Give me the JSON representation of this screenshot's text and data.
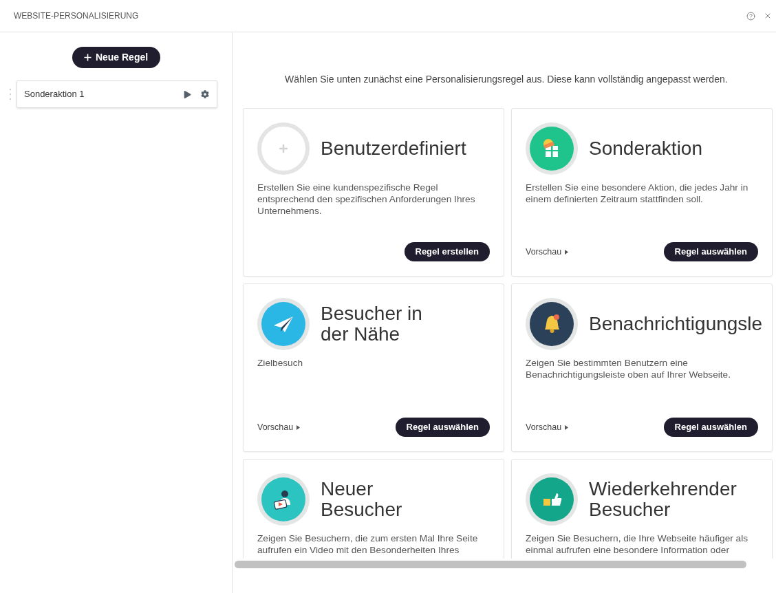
{
  "window": {
    "title": "WEBSITE-PERSONALISIERUNG"
  },
  "sidebar": {
    "new_rule_button": "Neue Regel",
    "rules": [
      {
        "name": "Sonderaktion 1"
      }
    ]
  },
  "intro": "Wählen Sie unten zunächst eine Personalisierungsregel aus. Diese kann vollständig angepasst werden.",
  "cards": [
    {
      "title": "Benutzerdefiniert",
      "description": "Erstellen Sie eine kundenspezifische Regel entsprechend den spezifischen Anforderungen Ihres Unternehmens.",
      "button": "Regel erstellen"
    },
    {
      "title": "Sonderaktion",
      "description": "Erstellen Sie eine besondere Aktion, die jedes Jahr in einem definierten Zeitraum stattfinden soll.",
      "preview": "Vorschau",
      "button": "Regel auswählen"
    },
    {
      "title": "Besucher in\nder Nähe",
      "description": "Zielbesuch",
      "preview": "Vorschau",
      "button": "Regel auswählen"
    },
    {
      "title": "Benachrichtigungsle",
      "description": "Zeigen Sie bestimmten Benutzern eine Benachrichtigungsleiste oben auf Ihrer Webseite.",
      "preview": "Vorschau",
      "button": "Regel auswählen"
    },
    {
      "title": "Neuer\nBesucher",
      "description": "Zeigen Sie Besuchern, die zum ersten Mal Ihre Seite aufrufen ein Video mit den Besonderheiten Ihres"
    },
    {
      "title": "Wiederkehrender\nBesucher",
      "description": "Zeigen Sie Besuchern, die Ihre Webseite häufiger als einmal aufrufen eine besondere Information oder"
    }
  ]
}
